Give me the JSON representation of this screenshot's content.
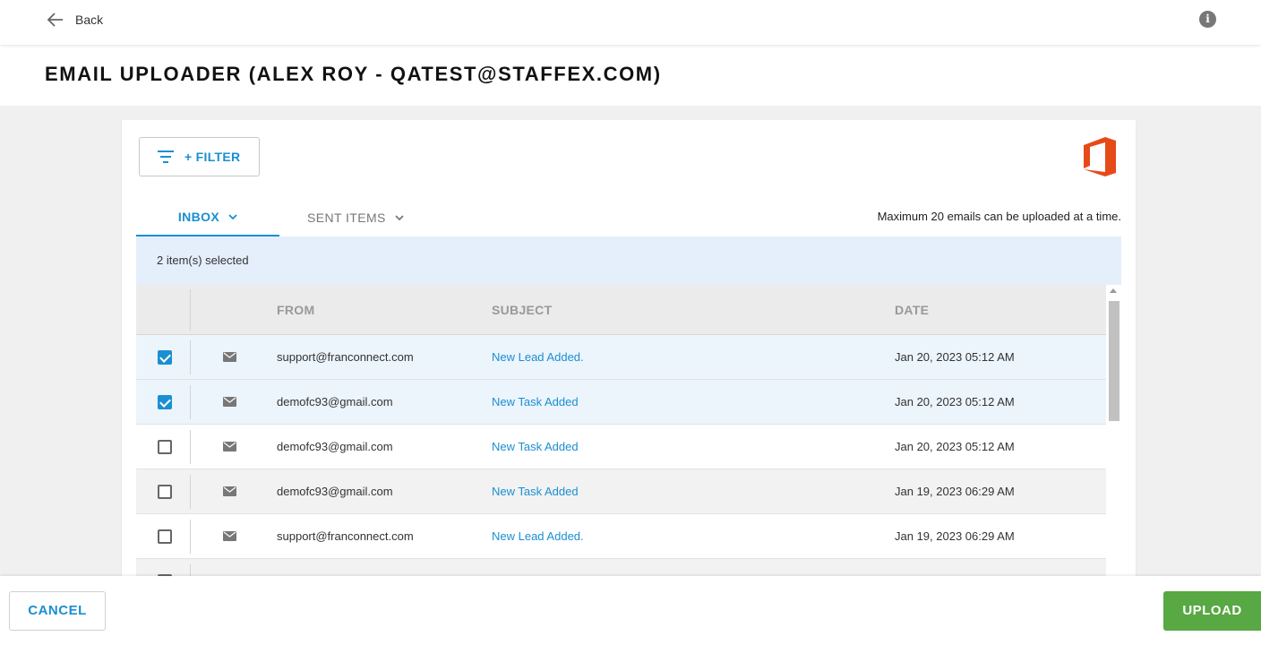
{
  "topbar": {
    "back_label": "Back",
    "back_icon": "arrow-left-icon",
    "info_icon": "info-icon"
  },
  "header": {
    "title": "EMAIL UPLOADER (ALEX ROY - QATEST@STAFFEX.COM)"
  },
  "toolbar": {
    "filter_label": "+ FILTER",
    "filter_icon": "filter-lines-icon",
    "provider_logo": "office-logo"
  },
  "tabs": [
    {
      "label": "INBOX",
      "active": true
    },
    {
      "label": "SENT ITEMS",
      "active": false
    }
  ],
  "max_note": "Maximum 20 emails can be uploaded at a time.",
  "selection": {
    "text": "2 item(s) selected"
  },
  "table": {
    "headers": {
      "from": "FROM",
      "subject": "SUBJECT",
      "date": "DATE"
    },
    "rows": [
      {
        "checked": true,
        "from": "support@franconnect.com",
        "subject": "New Lead Added.",
        "date": "Jan 20, 2023 05:12 AM"
      },
      {
        "checked": true,
        "from": "demofc93@gmail.com",
        "subject": "New Task Added",
        "date": "Jan 20, 2023 05:12 AM"
      },
      {
        "checked": false,
        "from": "demofc93@gmail.com",
        "subject": "New Task Added",
        "date": "Jan 20, 2023 05:12 AM"
      },
      {
        "checked": false,
        "from": "demofc93@gmail.com",
        "subject": "New Task Added",
        "date": "Jan 19, 2023 06:29 AM"
      },
      {
        "checked": false,
        "from": "support@franconnect.com",
        "subject": "New Lead Added.",
        "date": "Jan 19, 2023 06:29 AM"
      }
    ]
  },
  "footer": {
    "cancel_label": "CANCEL",
    "upload_label": "UPLOAD"
  },
  "colors": {
    "accent": "#1a8fd1",
    "upload": "#58a843",
    "office": "#e64a19",
    "selected_row": "#ecf4fc"
  }
}
